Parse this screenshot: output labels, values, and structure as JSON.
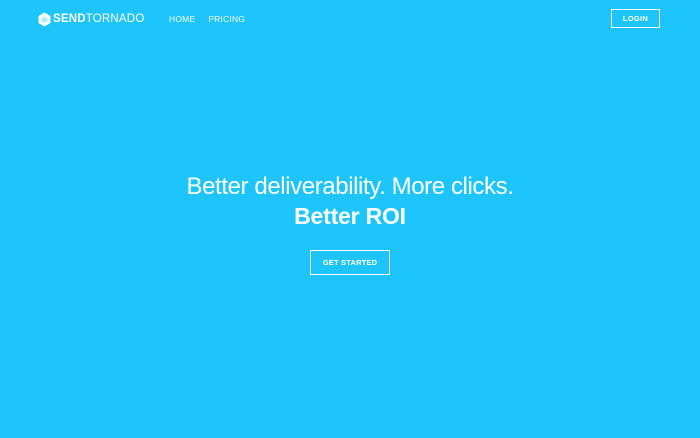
{
  "brand": {
    "name_bold": "SEND",
    "name_light": "TORNADO",
    "icon": "hexagon-logo-icon"
  },
  "nav": {
    "items": [
      {
        "label": "HOME"
      },
      {
        "label": "PRICING"
      }
    ]
  },
  "header": {
    "login_label": "LOGIN"
  },
  "hero": {
    "headline": "Better deliverability. More clicks.",
    "subheadline": "Better ROI",
    "cta_label": "GET STARTED"
  },
  "colors": {
    "background": "#1ec5fd",
    "text": "#ffffff"
  }
}
